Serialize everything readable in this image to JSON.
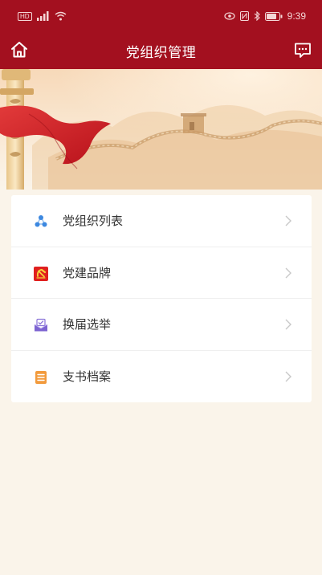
{
  "status_bar": {
    "hd_label": "HD",
    "time": "9:39"
  },
  "header": {
    "title": "党组织管理",
    "home_icon": "home-icon",
    "chat_icon": "message-icon"
  },
  "menu": {
    "items": [
      {
        "label": "党组织列表",
        "icon": "org-tree-icon"
      },
      {
        "label": "党建品牌",
        "icon": "party-emblem-icon"
      },
      {
        "label": "换届选举",
        "icon": "ballot-envelope-icon"
      },
      {
        "label": "支书档案",
        "icon": "archive-list-icon"
      }
    ]
  },
  "colors": {
    "brand_red": "#a3101f",
    "page_bg": "#faf4ea"
  }
}
